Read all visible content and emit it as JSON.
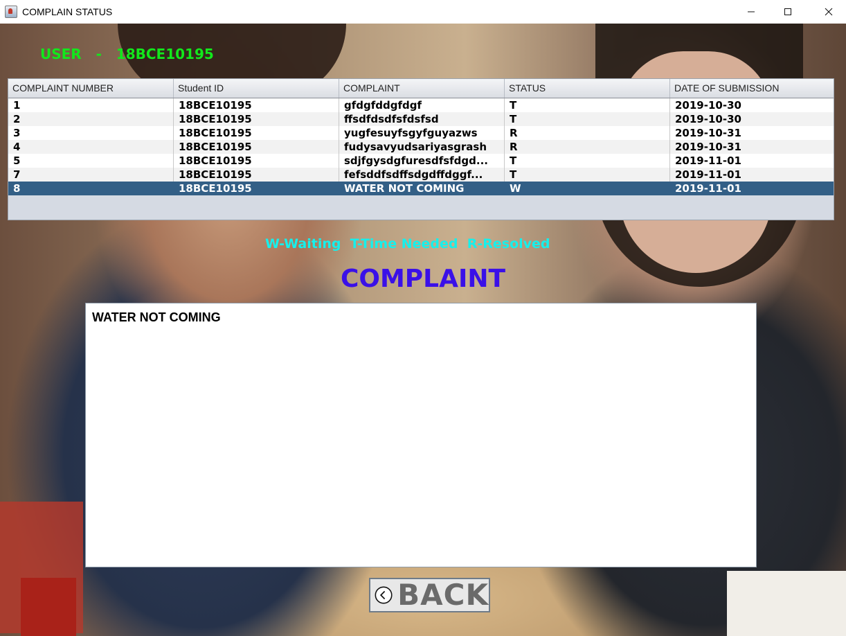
{
  "window": {
    "title": "COMPLAIN STATUS",
    "controls": [
      "minimize",
      "maximize",
      "close"
    ]
  },
  "user": {
    "label": "USER   -   18BCE10195"
  },
  "table": {
    "columns": [
      "COMPLAINT NUMBER",
      "Student ID",
      "COMPLAINT",
      "STATUS",
      "DATE OF SUBMISSION"
    ],
    "rows": [
      {
        "number": "1",
        "student_id": "18BCE10195",
        "complaint": "gfdgfddgfdgf",
        "status": "T",
        "date": "2019-10-30"
      },
      {
        "number": "2",
        "student_id": "18BCE10195",
        "complaint": "ffsdfdsdfsfdsfsd",
        "status": "T",
        "date": "2019-10-30"
      },
      {
        "number": "3",
        "student_id": "18BCE10195",
        "complaint": "yugfesuyfsgyfguyazws",
        "status": "R",
        "date": "2019-10-31"
      },
      {
        "number": "4",
        "student_id": "18BCE10195",
        "complaint": "fudysavyudsariyasgrash",
        "status": "R",
        "date": "2019-10-31"
      },
      {
        "number": "5",
        "student_id": "18BCE10195",
        "complaint": "sdjfgysdgfuresdfsfdgd...",
        "status": "T",
        "date": "2019-11-01"
      },
      {
        "number": "7",
        "student_id": "18BCE10195",
        "complaint": "fefsddfsdffsdgdffdggf...",
        "status": "T",
        "date": "2019-11-01"
      },
      {
        "number": "8",
        "student_id": "18BCE10195",
        "complaint": "WATER NOT COMING",
        "status": "W",
        "date": "2019-11-01",
        "selected": true
      }
    ]
  },
  "legend": "W-Waiting  T-Time Needed  R-Resolved",
  "heading": "COMPLAINT",
  "complaint_text": "WATER NOT COMING",
  "back_button": {
    "label": "BACK",
    "icon": "chevron-left-circle-icon"
  },
  "colors": {
    "user_label": "#12e81c",
    "legend": "#16f0ec",
    "heading": "#3a10e8",
    "selected_row": "#335f86"
  }
}
